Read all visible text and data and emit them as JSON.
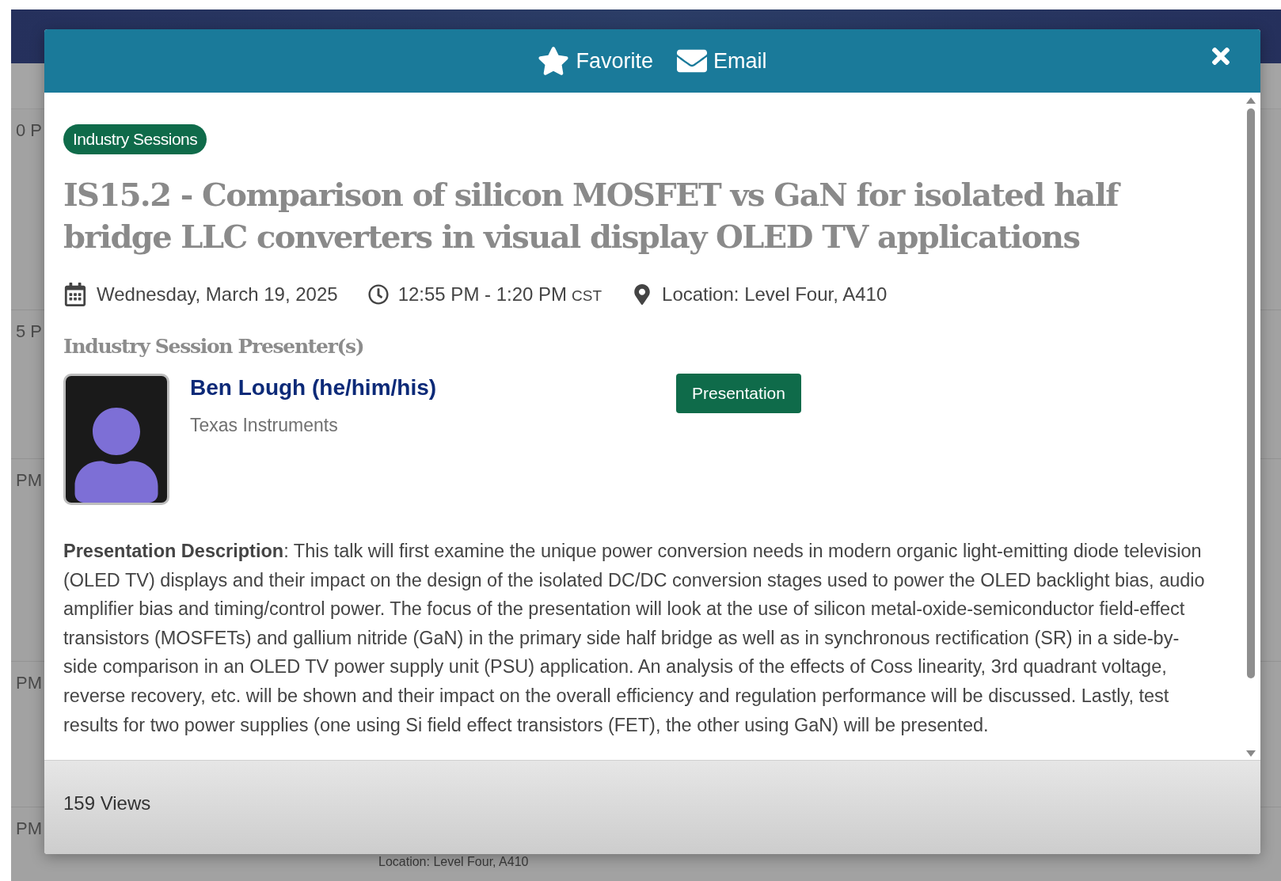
{
  "background": {
    "time_labels": [
      "0 P",
      "5 P",
      "PM",
      "PM",
      "PM"
    ],
    "location": "Location: Level Four, A410"
  },
  "modal": {
    "actions": [
      {
        "kind": "favorite",
        "label": "Favorite"
      },
      {
        "kind": "email",
        "label": "Email"
      }
    ],
    "category": "Industry Sessions",
    "title": "IS15.2 - Comparison of silicon MOSFET vs GaN for isolated half bridge LLC converters in visual display OLED TV applications",
    "date": "Wednesday, March 19, 2025",
    "time": "12:55 PM - 1:20 PM",
    "timezone": "CST",
    "location": "Location: Level Four, A410",
    "presenters_heading": "Industry Session Presenter(s)",
    "presenters": [
      {
        "name": "Ben Lough (he/him/his)",
        "company": "Texas Instruments"
      }
    ],
    "presentation_button": "Presentation",
    "description": "**Presentation Description**: This talk will first examine the unique power conversion needs in modern organic light-emitting diode television (OLED TV) displays and their impact on the design of the isolated DC/DC conversion stages used to power the OLED backlight bias, audio amplifier bias and timing/control power. The focus of the presentation will look at the use of silicon metal-oxide-semiconductor field-effect transistors (MOSFETs) and gallium nitride (GaN) in the primary side half bridge as well as in synchronous rectification (SR) in a side-by-side comparison in an OLED TV power supply unit (PSU) application. An analysis of the effects of Coss linearity, 3rd quadrant voltage, reverse recovery, etc. will be shown and their impact on the overall efficiency and regulation performance will be discussed. Lastly, test results for two power supplies (one using Si field effect transistors (FET), the other using GaN) will be presented.",
    "views": "159 Views"
  }
}
